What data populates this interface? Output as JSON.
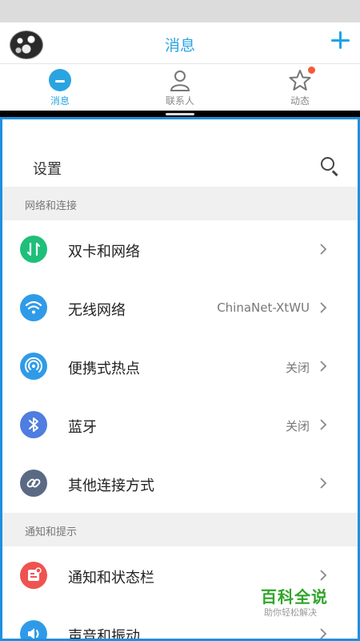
{
  "app": {
    "title": "消息",
    "tabs": [
      {
        "label": "消息",
        "icon": "message-bubble-icon",
        "active": true
      },
      {
        "label": "联系人",
        "icon": "contacts-person-icon",
        "active": false
      },
      {
        "label": "动态",
        "icon": "star-icon",
        "active": false
      }
    ]
  },
  "settings": {
    "title": "设置",
    "sections": [
      {
        "header": "网络和连接",
        "items": [
          {
            "label": "双卡和网络",
            "value": "",
            "icon": "dual-sim-icon",
            "color": "#1fbf7a"
          },
          {
            "label": "无线网络",
            "value": "ChinaNet-XtWU",
            "icon": "wifi-icon",
            "color": "#2f9be8"
          },
          {
            "label": "便携式热点",
            "value": "关闭",
            "icon": "hotspot-icon",
            "color": "#2f9be8"
          },
          {
            "label": "蓝牙",
            "value": "关闭",
            "icon": "bluetooth-icon",
            "color": "#4f7de0"
          },
          {
            "label": "其他连接方式",
            "value": "",
            "icon": "link-icon",
            "color": "#5a6a85"
          }
        ]
      },
      {
        "header": "通知和提示",
        "items": [
          {
            "label": "通知和状态栏",
            "value": "",
            "icon": "notification-icon",
            "color": "#ef5350"
          },
          {
            "label": "声音和振动",
            "value": "",
            "icon": "sound-icon",
            "color": "#2f9be8"
          }
        ]
      }
    ]
  },
  "watermark": {
    "title": "百科全说",
    "subtitle": "助你轻松解决"
  },
  "colors": {
    "accent": "#2aa4e0",
    "panel_border": "#1f8fe0",
    "section_bg": "#f0f0f0"
  }
}
